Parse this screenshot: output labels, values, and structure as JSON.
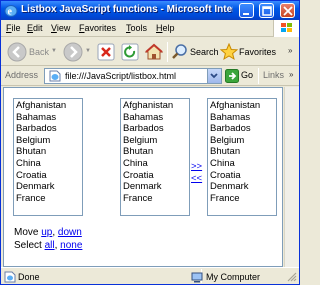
{
  "window": {
    "title": "Listbox JavaScript functions - Microsoft Internet Explorer"
  },
  "menu": [
    {
      "u": "F",
      "rest": "ile"
    },
    {
      "u": "E",
      "rest": "dit"
    },
    {
      "u": "V",
      "rest": "iew"
    },
    {
      "u": "F",
      "rest": "avorites"
    },
    {
      "u": "T",
      "rest": "ools"
    },
    {
      "u": "H",
      "rest": "elp"
    }
  ],
  "toolbar": {
    "back_label": "Back",
    "search_label": "Search",
    "favorites_label": "Favorites"
  },
  "address": {
    "label": "Address",
    "url": "file:///JavaScript/listbox.html",
    "go_label": "Go",
    "links_label": "Links"
  },
  "lists": {
    "left": [
      "Afghanistan",
      "Bahamas",
      "Barbados",
      "Belgium",
      "Bhutan",
      "China",
      "Croatia",
      "Denmark",
      "France"
    ],
    "middle": [
      "Afghanistan",
      "Bahamas",
      "Barbados",
      "Belgium",
      "Bhutan",
      "China",
      "Croatia",
      "Denmark",
      "France"
    ],
    "right": [
      "Afghanistan",
      "Bahamas",
      "Barbados",
      "Belgium",
      "Bhutan",
      "China",
      "Croatia",
      "Denmark",
      "France"
    ]
  },
  "transfer": {
    "move_right": ">>",
    "move_left": "<<"
  },
  "controls": {
    "move_label": "Move",
    "up": "up",
    "down": "down",
    "select_label": "Select",
    "all": "all",
    "none": "none"
  },
  "status": {
    "text": "Done",
    "zone": "My Computer"
  },
  "colors": {
    "titlebar": "#0054E3",
    "link": "#0000EE",
    "chrome": "#ECE9D8"
  }
}
